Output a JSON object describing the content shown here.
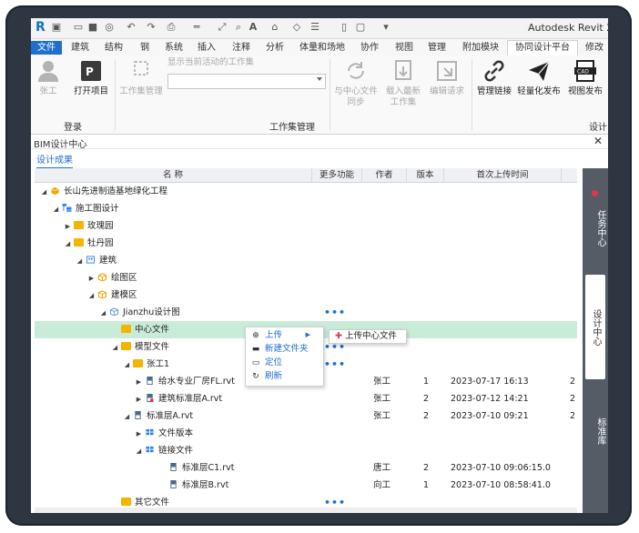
{
  "titlebar": {
    "app_title": "Autodesk Revit 2"
  },
  "ribbon_tabs": [
    "文件",
    "建筑",
    "结构",
    "钢",
    "系统",
    "插入",
    "注释",
    "分析",
    "体量和场地",
    "协作",
    "视图",
    "管理",
    "附加模块",
    "协同设计平台",
    "修改"
  ],
  "ribbon": {
    "user_label": "张工",
    "open_project": "打开项目",
    "workset_manage": "工作集管理",
    "show_workset": "显示当前活动的工作集",
    "sync_central": "与中心文件同步",
    "load_latest": "载入最新工作集",
    "edit_request": "编辑请求",
    "manage_link": "管理链接",
    "light_publish": "轻量化发布",
    "view_publish": "视图发布",
    "panel_login": "登录",
    "panel_workset": "工作集管理",
    "panel_design": "设计"
  },
  "panel": {
    "title": "BIM设计中心",
    "close": "✕",
    "subtab": "设计成果"
  },
  "table": {
    "headers": {
      "name": "名 称",
      "more": "更多功能",
      "author": "作者",
      "version": "版本",
      "uploaded": "首次上传时间"
    },
    "rows": [
      {
        "level": 0,
        "arrow": "◢",
        "icon": "pkg",
        "name": "长山先进制造基地绿化工程",
        "more": "",
        "author": "",
        "version": "",
        "time": ""
      },
      {
        "level": 1,
        "arrow": "◢",
        "icon": "tree",
        "name": "施工图设计",
        "more": "",
        "author": "",
        "version": "",
        "time": ""
      },
      {
        "level": 2,
        "arrow": "▶",
        "icon": "folder",
        "name": "玫瑰园",
        "more": "",
        "author": "",
        "version": "",
        "time": ""
      },
      {
        "level": 2,
        "arrow": "◢",
        "icon": "folder",
        "name": "牡丹园",
        "more": "",
        "author": "",
        "version": "",
        "time": ""
      },
      {
        "level": 3,
        "arrow": "◢",
        "icon": "build",
        "name": "建筑",
        "more": "",
        "author": "",
        "version": "",
        "time": ""
      },
      {
        "level": 4,
        "arrow": "▶",
        "icon": "cube",
        "name": "绘图区",
        "more": "",
        "author": "",
        "version": "",
        "time": ""
      },
      {
        "level": 4,
        "arrow": "◢",
        "icon": "cube",
        "name": "建模区",
        "more": "",
        "author": "",
        "version": "",
        "time": ""
      },
      {
        "level": 5,
        "arrow": "◢",
        "icon": "cube2",
        "name": "Jianzhu设计图",
        "more": "•••",
        "author": "",
        "version": "",
        "time": ""
      },
      {
        "level": 6,
        "arrow": "",
        "icon": "folder",
        "name": "中心文件",
        "more": "",
        "author": "",
        "version": "",
        "time": "",
        "selected": true
      },
      {
        "level": 6,
        "arrow": "◢",
        "icon": "folder",
        "name": "模型文件",
        "more": "•••",
        "author": "",
        "version": "",
        "time": ""
      },
      {
        "level": 7,
        "arrow": "◢",
        "icon": "folder",
        "name": "张工1",
        "more": "•••",
        "author": "",
        "version": "",
        "time": ""
      },
      {
        "level": 8,
        "arrow": "▶",
        "icon": "rvt",
        "name": "给水专业厂房FL.rvt",
        "more": "",
        "author": "张工",
        "version": "1",
        "time": "2023-07-17 16:13",
        "extra": "2"
      },
      {
        "level": 8,
        "arrow": "▶",
        "icon": "rvtred",
        "name": "建筑标准层A.rvt",
        "more": "",
        "author": "张工",
        "version": "2",
        "time": "2023-07-12 14:21",
        "extra": "2"
      },
      {
        "level": 7,
        "arrow": "◢",
        "icon": "rvt",
        "name": "标准层A.rvt",
        "more": "",
        "author": "张工",
        "version": "2",
        "time": "2023-07-10 09:21",
        "extra": "2"
      },
      {
        "level": 8,
        "arrow": "▶",
        "icon": "grid",
        "name": "文件版本",
        "more": "",
        "author": "",
        "version": "",
        "time": ""
      },
      {
        "level": 8,
        "arrow": "◢",
        "icon": "grid",
        "name": "链接文件",
        "more": "",
        "author": "",
        "version": "",
        "time": ""
      },
      {
        "level": 10,
        "arrow": "",
        "icon": "rvt",
        "name": "标准层C1.rvt",
        "more": "",
        "author": "唐工",
        "version": "2",
        "time": "2023-07-10 09:06:15.0",
        "extra": ""
      },
      {
        "level": 10,
        "arrow": "",
        "icon": "rvt",
        "name": "标准层B.rvt",
        "more": "",
        "author": "向工",
        "version": "1",
        "time": "2023-07-10 08:58:41.0",
        "extra": ""
      },
      {
        "level": 6,
        "arrow": "",
        "icon": "folder",
        "name": "其它文件",
        "more": "•••",
        "author": "",
        "version": "",
        "time": ""
      }
    ]
  },
  "context_menu": {
    "upload": "上传",
    "new_folder": "新建文件夹",
    "locate": "定位",
    "refresh": "刷新",
    "sub_upload_central": "上传中心文件"
  },
  "side_tabs": {
    "task_center": "任务中心",
    "design_center": "设计中心",
    "standard_lib": "标准库"
  },
  "colors": {
    "accent": "#1e6fd0",
    "selected_row": "#c9ecd9",
    "folder": "#f5b400",
    "sidebar": "#555c66"
  }
}
